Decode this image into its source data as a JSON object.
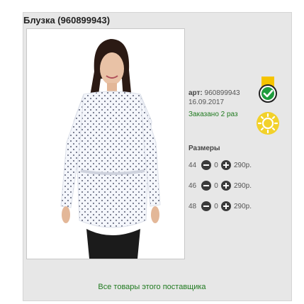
{
  "product": {
    "title": "Блузка (960899943)",
    "article_label": "арт:",
    "article_value": "960899943",
    "date": "16.09.2017",
    "ordered": "Заказано 2 раз",
    "sizes_label": "Размеры",
    "sizes": [
      {
        "size": "44",
        "qty": "0",
        "price": "290р."
      },
      {
        "size": "46",
        "qty": "0",
        "price": "290р."
      },
      {
        "size": "48",
        "qty": "0",
        "price": "290р."
      }
    ]
  },
  "footer": {
    "supplier_link": "Все товары этого поставщика"
  },
  "icons": {
    "badge": "check-badge-icon",
    "sun": "sun-icon",
    "minus": "minus-icon",
    "plus": "plus-icon"
  },
  "colors": {
    "accent_green": "#1f7a1f",
    "badge_yellow": "#f5c400",
    "check_green": "#1e9c3d",
    "panel_bg": "#e7e7e7"
  }
}
